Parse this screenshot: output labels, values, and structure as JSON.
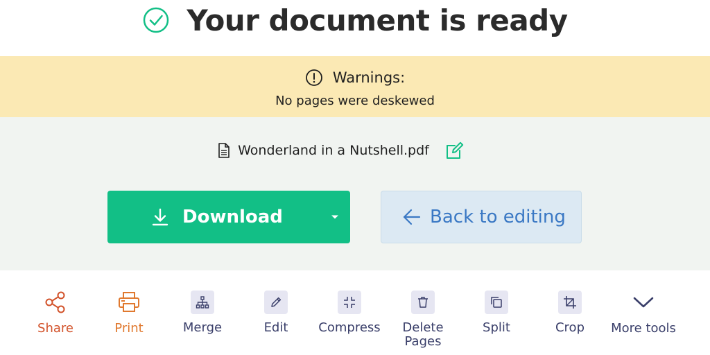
{
  "header": {
    "title": "Your document is ready"
  },
  "warning": {
    "title": "Warnings:",
    "message": "No pages were deskewed"
  },
  "file": {
    "name": "Wonderland in a Nutshell.pdf"
  },
  "buttons": {
    "download": "Download",
    "back": "Back to editing"
  },
  "tools": [
    {
      "label": "Share",
      "icon": "share-icon"
    },
    {
      "label": "Print",
      "icon": "printer-icon"
    },
    {
      "label": "Merge",
      "icon": "merge-icon"
    },
    {
      "label": "Edit",
      "icon": "pencil-icon"
    },
    {
      "label": "Compress",
      "icon": "compress-icon"
    },
    {
      "label": "Delete Pages",
      "icon": "trash-icon"
    },
    {
      "label": "Split",
      "icon": "split-icon"
    },
    {
      "label": "Crop",
      "icon": "crop-icon"
    },
    {
      "label": "More tools",
      "icon": "chevron-down-icon"
    }
  ],
  "colors": {
    "accent_green": "#12bf86",
    "warning_bg": "#fbe9b4",
    "panel_bg": "#f1f4f1",
    "back_btn_bg": "#dce9f3",
    "back_btn_text": "#3a78c4",
    "share_color": "#d2522a",
    "print_color": "#e0792f",
    "tool_text": "#3a3f6a"
  }
}
